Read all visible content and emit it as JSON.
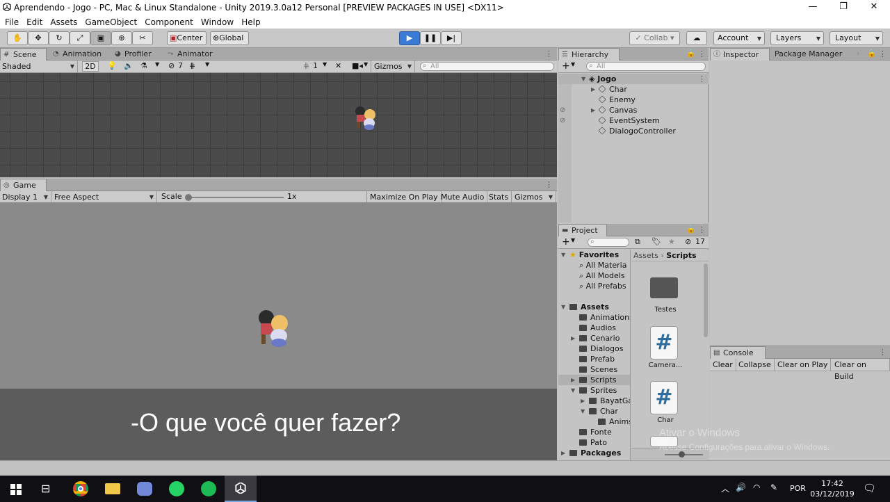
{
  "window": {
    "title": "Aprendendo - Jogo - PC, Mac & Linux Standalone - Unity 2019.3.0a12 Personal [PREVIEW PACKAGES IN USE] <DX11>",
    "controls": [
      "—",
      "❐",
      "✕"
    ]
  },
  "menu": [
    "File",
    "Edit",
    "Assets",
    "GameObject",
    "Component",
    "Window",
    "Help"
  ],
  "toolbar": {
    "pivot": "Center",
    "space": "Global",
    "collab": "Collab",
    "account": "Account",
    "layers": "Layers",
    "layout": "Layout",
    "play_icon": "play-icon",
    "pause_icon": "pause-icon",
    "step_icon": "step-icon"
  },
  "scene_tabs": {
    "scene": "Scene",
    "animation": "Animation",
    "profiler": "Profiler",
    "animator": "Animator"
  },
  "scene_bar": {
    "shading": "Shaded",
    "mode2d": "2D",
    "hidden_count": "7",
    "layer_count": "1",
    "gizmos": "Gizmos",
    "search_placeholder": "All"
  },
  "game": {
    "tab": "Game",
    "display": "Display 1",
    "aspect": "Free Aspect",
    "scale_label": "Scale",
    "scale_value": "1x",
    "maximize": "Maximize On Play",
    "mute": "Mute Audio",
    "stats": "Stats",
    "gizmos": "Gizmos",
    "dialog_text": "-O que você quer fazer?"
  },
  "hierarchy": {
    "tab": "Hierarchy",
    "search_placeholder": "All",
    "scene": "Jogo",
    "items": [
      "Char",
      "Enemy",
      "Canvas",
      "EventSystem",
      "DialogoController"
    ]
  },
  "inspector": {
    "tab": "Inspector",
    "package_manager": "Package Manager"
  },
  "project": {
    "tab": "Project",
    "count": "17",
    "favorites": "Favorites",
    "favorite_items": [
      "All Materia",
      "All Models",
      "All Prefabs"
    ],
    "assets": "Assets",
    "asset_folders": [
      "Animations",
      "Audios",
      "Cenario",
      "Dialogos",
      "Prefab",
      "Scenes",
      "Scripts",
      "Sprites",
      "BayatGa",
      "Char",
      "Anims",
      "Fonte",
      "Pato"
    ],
    "packages": "Packages",
    "breadcrumb_root": "Assets",
    "breadcrumb_current": "Scripts",
    "grid_items": [
      "Testes",
      "Camera...",
      "Char"
    ]
  },
  "console": {
    "tab": "Console",
    "buttons": [
      "Clear",
      "Collapse",
      "Clear on Play",
      "Clear on Build"
    ]
  },
  "watermark": {
    "line1": "Ativar o Windows",
    "line2": "Acesse Configurações para ativar o Windows."
  },
  "taskbar": {
    "lang": "POR",
    "time": "17:42",
    "date": "03/12/2019"
  },
  "colors": {
    "play_active": "#3a7bd5",
    "scene_bg": "#4b4b4b",
    "game_bg": "#8a8a8a",
    "dialog_bg": "#5c5c5c"
  }
}
